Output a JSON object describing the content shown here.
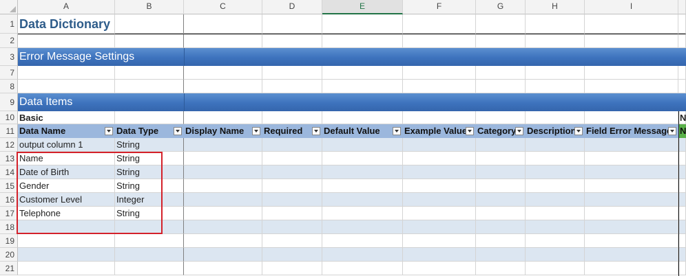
{
  "columns": [
    "A",
    "B",
    "C",
    "D",
    "E",
    "F",
    "G",
    "H",
    "I"
  ],
  "rows": [
    "1",
    "2",
    "3",
    "7",
    "8",
    "9",
    "10",
    "11",
    "12",
    "13",
    "14",
    "15",
    "16",
    "17",
    "18",
    "19",
    "20",
    "21"
  ],
  "title": "Data Dictionary",
  "section_error": "Error Message Settings",
  "section_items": "Data Items",
  "basic_label": "Basic",
  "overflow_j10": "N",
  "overflow_j11": "N",
  "table_headers": [
    "Data Name",
    "Data Type",
    "Display Name",
    "Required",
    "Default Value",
    "Example Value",
    "Category",
    "Description",
    "Field Error Message"
  ],
  "data_items": [
    {
      "name": "output column 1",
      "type": "String"
    },
    {
      "name": "Name",
      "type": "String"
    },
    {
      "name": "Date of Birth",
      "type": "String"
    },
    {
      "name": "Gender",
      "type": "String"
    },
    {
      "name": "Customer Level",
      "type": "Integer"
    },
    {
      "name": "Telephone",
      "type": "String"
    }
  ],
  "colors": {
    "band": "#3d72bd",
    "header_row": "#9bb7dd",
    "banded": "#dce6f1",
    "highlight": "#d4212a",
    "title": "#2e5c8a",
    "selected_column": "#217346"
  }
}
